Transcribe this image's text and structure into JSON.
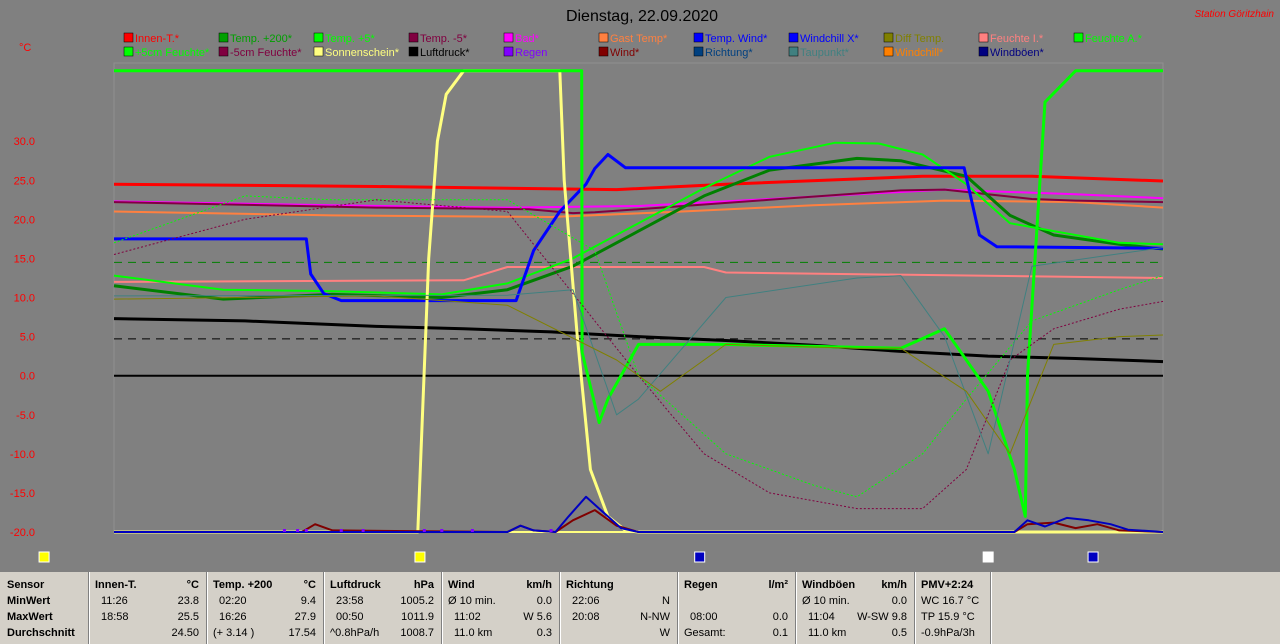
{
  "header": {
    "title": "Dienstag, 22.09.2020",
    "station": "Station Göritzhain",
    "yunit": "°C"
  },
  "colors": {
    "bg": "#808080",
    "plot": "#808080"
  },
  "chart_data": {
    "type": "line",
    "title": "Dienstag, 22.09.2020",
    "ylabel": "°C",
    "ylim": [
      -20,
      40
    ],
    "yticks": [
      "30.0",
      "25.0",
      "20.0",
      "15.0",
      "10.0",
      "5.0",
      "0.0",
      "-5.0",
      "-10.0",
      "-15.0",
      "-20.0"
    ],
    "xlim": [
      0,
      24
    ],
    "legend": [
      {
        "label": "Innen-T.*",
        "color": "#ff0000"
      },
      {
        "label": "Temp. +200*",
        "color": "#00a000"
      },
      {
        "label": "Temp. +5*",
        "color": "#00ff00"
      },
      {
        "label": "Temp. -5*",
        "color": "#800040"
      },
      {
        "label": "Bad*",
        "color": "#ff00ff"
      },
      {
        "label": "Gast Temp*",
        "color": "#ff8040"
      },
      {
        "label": "Temp. Wind*",
        "color": "#0000ff"
      },
      {
        "label": "Windchill X*",
        "color": "#0000ff"
      },
      {
        "label": "Diff Temp.",
        "color": "#808000"
      },
      {
        "label": "Feuchte I.*",
        "color": "#ff8080"
      },
      {
        "label": "Feuchte A.*",
        "color": "#00ff00"
      },
      {
        "label": "+5cm Feuchte*",
        "color": "#00ff00"
      },
      {
        "label": "-5cm Feuchte*",
        "color": "#800040"
      },
      {
        "label": "Sonnenschein*",
        "color": "#ffff80"
      },
      {
        "label": "Luftdruck*",
        "color": "#000000"
      },
      {
        "label": "Regen",
        "color": "#8000ff"
      },
      {
        "label": "Wind*",
        "color": "#800000"
      },
      {
        "label": "Richtung*",
        "color": "#004080"
      },
      {
        "label": "Taupunkt*",
        "color": "#408080"
      },
      {
        "label": "Windchill*",
        "color": "#ff8000"
      },
      {
        "label": "Windböen*",
        "color": "#000080"
      }
    ],
    "series": [
      {
        "name": "Innen-T.*",
        "color": "#ff0000",
        "width": 3,
        "x": [
          0,
          6,
          11.5,
          14,
          18.5,
          21,
          24
        ],
        "y": [
          24.5,
          24.2,
          23.8,
          24.5,
          25.5,
          25.5,
          24.9
        ]
      },
      {
        "name": "Bad*",
        "color": "#ff00ff",
        "width": 2,
        "x": [
          0,
          5,
          9,
          12,
          15,
          19,
          22,
          24
        ],
        "y": [
          22.3,
          21.8,
          21.5,
          21.7,
          22.6,
          23.8,
          23.2,
          22.7
        ]
      },
      {
        "name": "Gast Temp*",
        "color": "#ff8040",
        "width": 2,
        "x": [
          0,
          5,
          10,
          13,
          16,
          19,
          22,
          24
        ],
        "y": [
          21.0,
          20.5,
          20.3,
          21.0,
          21.8,
          22.4,
          22.2,
          21.5
        ]
      },
      {
        "name": "Temp. -5*",
        "color": "#800040",
        "width": 2,
        "x": [
          0,
          6,
          9.5,
          10.5,
          11,
          12,
          15,
          18,
          19,
          21,
          22,
          24
        ],
        "y": [
          22.2,
          21.5,
          21.3,
          20.8,
          20.9,
          21.3,
          22.5,
          23.7,
          23.8,
          22.6,
          22.4,
          22.2
        ]
      },
      {
        "name": "Feuchte I.*",
        "color": "#ff8080",
        "width": 2,
        "x": [
          0,
          8,
          9,
          13.5,
          14,
          24
        ],
        "y": [
          12.0,
          12.2,
          13.9,
          13.9,
          13.2,
          12.5
        ]
      },
      {
        "name": "Temp. +200*",
        "color": "#008000",
        "width": 3,
        "x": [
          0,
          2.5,
          5,
          7.5,
          9,
          10.5,
          12,
          13.5,
          15,
          17,
          18,
          19.5,
          20.5,
          21.5,
          23,
          24
        ],
        "y": [
          11.5,
          9.8,
          10.4,
          10.0,
          11.0,
          14.0,
          18.5,
          23.0,
          26.3,
          27.8,
          27.5,
          25.5,
          20.5,
          18.0,
          16.8,
          16.2
        ]
      },
      {
        "name": "Temp. +5*",
        "color": "#00ff00",
        "width": 2,
        "x": [
          0,
          2.5,
          5,
          7.5,
          9,
          10.5,
          12,
          13.5,
          15,
          16.5,
          17.5,
          18.5,
          19.5,
          20.5,
          21.5,
          23,
          24
        ],
        "y": [
          12.8,
          11.0,
          10.8,
          10.4,
          11.8,
          15.0,
          19.5,
          24.0,
          28.0,
          29.8,
          29.7,
          28.3,
          24.5,
          19.5,
          18.5,
          17.0,
          16.8
        ]
      },
      {
        "name": "Temp. Wind*",
        "color": "#0000ff",
        "width": 3,
        "x": [
          0,
          4.4,
          4.5,
          4.8,
          5.2,
          9.2,
          9.6,
          10.2,
          10.8,
          11,
          11.3,
          11.7,
          15,
          18,
          19,
          19.45,
          19.8,
          20.2,
          24
        ],
        "y": [
          17.5,
          17.5,
          13.0,
          10.5,
          9.6,
          9.6,
          16.0,
          21.0,
          24.5,
          26.5,
          28.3,
          26.6,
          26.6,
          26.6,
          26.6,
          26.6,
          18.0,
          16.5,
          16.3
        ]
      },
      {
        "name": "Luftdruck*",
        "color": "#000000",
        "width": 3,
        "x": [
          0,
          3,
          6,
          8,
          10,
          12,
          14,
          16,
          18,
          20,
          22,
          24
        ],
        "y": [
          7.3,
          7.0,
          6.3,
          6.0,
          5.6,
          5.0,
          4.5,
          3.9,
          3.1,
          2.5,
          2.2,
          1.8
        ]
      },
      {
        "name": "Zero",
        "color": "#000000",
        "width": 2,
        "x": [
          0,
          24
        ],
        "y": [
          0,
          0
        ]
      },
      {
        "name": "Sonnenschein*",
        "color": "#ffff80",
        "width": 3,
        "x": [
          0,
          6.95,
          7.2,
          7.4,
          7.6,
          8,
          10.2,
          10.3,
          10.6,
          10.9,
          11.3,
          11.7,
          12,
          24
        ],
        "y": [
          -20,
          -20,
          15,
          30,
          36,
          39,
          39,
          25,
          5,
          -12,
          -18,
          -19.8,
          -20,
          -20
        ]
      },
      {
        "name": "Feuchte A.*",
        "color": "#00ff00",
        "width": 3,
        "x": [
          0,
          10.7,
          10.71,
          11.1,
          11.3,
          12,
          14,
          18,
          19,
          20,
          20.6,
          20.85,
          20.9,
          21.3,
          22,
          24
        ],
        "y": [
          39,
          39,
          3,
          -6,
          -3,
          4,
          4,
          3.5,
          6,
          -2,
          -12,
          -18,
          0,
          35,
          39,
          39
        ]
      },
      {
        "name": "Wind*",
        "color": "#800000",
        "width": 2,
        "x": [
          0,
          4.3,
          4.6,
          5,
          9.0,
          9.3,
          9.6,
          10.1,
          10.5,
          11,
          11.5,
          12,
          20.6,
          20.9,
          21.5,
          22,
          22.5,
          23,
          24
        ],
        "y": [
          -20,
          -20,
          -19,
          -19.8,
          -20,
          -19.2,
          -19.8,
          -20,
          -18.5,
          -17.2,
          -19.2,
          -20,
          -20,
          -19,
          -18.8,
          -19.5,
          -19,
          -19.8,
          -20
        ]
      },
      {
        "name": "Windböen*",
        "color": "#0000c0",
        "width": 2,
        "x": [
          0,
          9.0,
          9.3,
          9.6,
          10.1,
          10.4,
          10.8,
          11.2,
          11.6,
          12,
          20.6,
          20.9,
          21.3,
          21.8,
          22.3,
          22.8,
          23.2,
          24
        ],
        "y": [
          -20,
          -20,
          -19.2,
          -19.8,
          -20,
          -18,
          -15.5,
          -17.5,
          -19.5,
          -20,
          -20,
          -18.5,
          -19.3,
          -18.2,
          -18.5,
          -19,
          -19.7,
          -20
        ]
      },
      {
        "name": "-5cm Feuchte*",
        "color": "#800040",
        "width": 1,
        "dash": "2,2",
        "x": [
          0,
          3,
          6,
          9,
          12,
          13.5,
          15,
          17,
          18.5,
          19.5,
          20.5,
          21.5,
          23,
          24
        ],
        "y": [
          15.5,
          20,
          22.5,
          21.0,
          0,
          -10,
          -15,
          -17,
          -17,
          -12,
          2,
          6,
          8.5,
          9.5
        ]
      },
      {
        "name": "+5cm Feuchte*",
        "color": "#00ff00",
        "width": 1,
        "dash": "2,2",
        "x": [
          0,
          3,
          5,
          9,
          11,
          12,
          14,
          16,
          17,
          18.5,
          19.5,
          21,
          23,
          24
        ],
        "y": [
          17,
          23,
          22.5,
          22.5,
          16,
          0,
          -10,
          -14,
          -15.5,
          -10,
          -3,
          7,
          11,
          12.8
        ]
      },
      {
        "name": "Taupunkt*",
        "color": "#408080",
        "width": 1,
        "x": [
          0,
          9,
          10.5,
          11.5,
          12,
          14,
          17,
          18,
          19,
          20,
          21,
          24
        ],
        "y": [
          10.2,
          10.3,
          11.0,
          -5,
          -3,
          10,
          12.5,
          12.8,
          5,
          -10,
          14,
          16.4
        ]
      },
      {
        "name": "Windchill*",
        "color": "#808000",
        "width": 1,
        "x": [
          0,
          6,
          9,
          11.5,
          12.5,
          14,
          17,
          18,
          19.5,
          20.5,
          21.5,
          23,
          24
        ],
        "y": [
          9.8,
          10.2,
          9.0,
          2.0,
          -2.0,
          4.0,
          3.5,
          3.5,
          -2.0,
          -10.0,
          4.0,
          5.0,
          5.2
        ]
      }
    ],
    "hlines": [
      {
        "y": 14.5,
        "color": "#008000",
        "dash": "8,6"
      },
      {
        "y": 4.7,
        "color": "#000000",
        "dash": "8,6"
      }
    ],
    "rain_marks": [
      3.9,
      4.2,
      4.4,
      5.2,
      5.7,
      7.1,
      7.5,
      8.2,
      10.0
    ],
    "markers": [
      {
        "x": -1.6,
        "color": "#ffff00"
      },
      {
        "x": 7.0,
        "color": "#ffff00"
      },
      {
        "x": 13.4,
        "color": "#0000c0"
      },
      {
        "x": 20.0,
        "color": "#ffffff"
      },
      {
        "x": 22.4,
        "color": "#0000c0"
      }
    ]
  },
  "table": {
    "rowlabels": [
      "Sensor",
      "MinWert",
      "MaxWert",
      "Durchschnitt"
    ],
    "innen": {
      "title": "Innen-T.",
      "unit": "°C",
      "min_t": "11:26",
      "min_v": "23.8",
      "max_t": "18:58",
      "max_v": "25.5",
      "avg_v": "24.50"
    },
    "temp200": {
      "title": "Temp. +200",
      "unit": "°C",
      "min_t": "02:20",
      "min_v": "9.4",
      "max_t": "16:26",
      "max_v": "27.9",
      "avg_t": "(+ 3.14 )",
      "avg_v": "17.54"
    },
    "druck": {
      "title": "Luftdruck",
      "unit": "hPa",
      "min_t": "23:58",
      "min_v": "1005.2",
      "max_t": "00:50",
      "max_v": "1011.9",
      "avg_t": "^0.8hPa/h",
      "avg_v": "1008.7"
    },
    "wind": {
      "title": "Wind",
      "unit": "km/h",
      "min_t": "Ø 10 min.",
      "min_v": "0.0",
      "max_t": "11:02",
      "max_v": "W 5.6",
      "avg_t": "11.0 km",
      "avg_v": "0.3"
    },
    "richtung": {
      "title": "Richtung",
      "min_t": "22:06",
      "min_v": "N",
      "max_t": "20:08",
      "max_v": "N-NW",
      "avg_v": "W"
    },
    "regen": {
      "title": "Regen",
      "unit": "l/m²",
      "max_t": "08:00",
      "max_v": "0.0",
      "avg_t": "Gesamt:",
      "avg_v": "0.1"
    },
    "boeen": {
      "title": "Windböen",
      "unit": "km/h",
      "min_t": "Ø 10 min.",
      "min_v": "0.0",
      "max_t": "11:04",
      "max_v": "W-SW 9.8",
      "avg_t": "11.0 km",
      "avg_v": "0.5"
    },
    "pmv": {
      "title": "PMV+2:24",
      "wc": "WC 16.7 °C",
      "tp": "TP 15.9 °C",
      "dp": "-0.9hPa/3h"
    }
  }
}
